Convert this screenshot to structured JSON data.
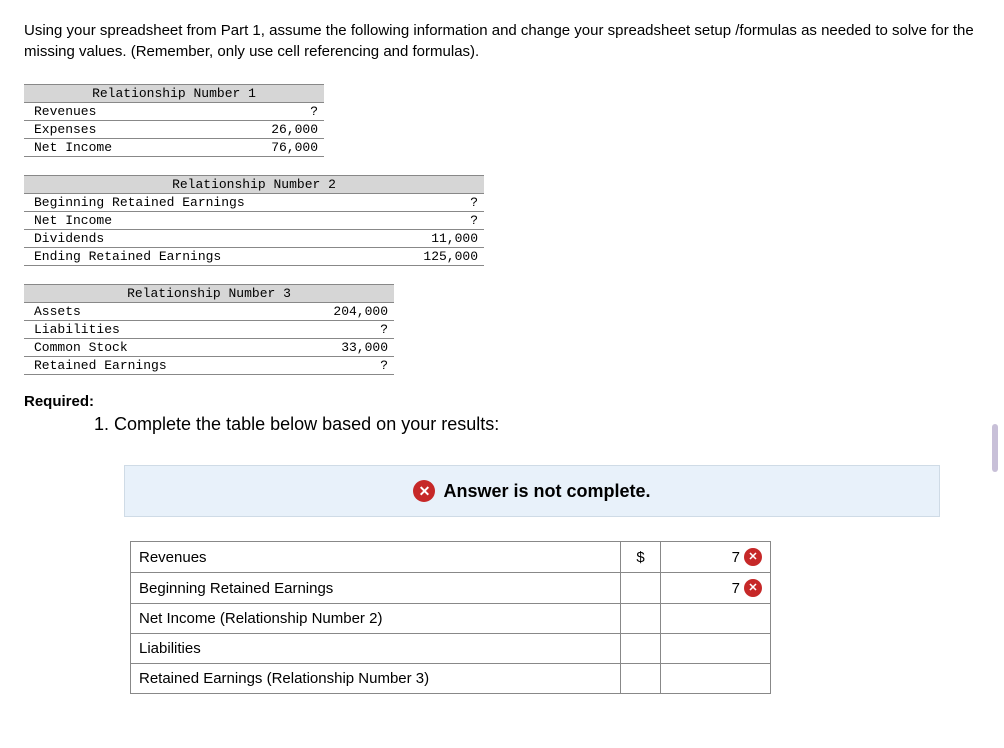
{
  "instructions": "Using your spreadsheet from Part 1, assume the following information and change your spreadsheet setup /formulas as needed to solve for the missing values. (Remember, only use cell referencing and formulas).",
  "rel1": {
    "title": "Relationship Number 1",
    "rows": [
      {
        "label": "Revenues",
        "value": "?"
      },
      {
        "label": "Expenses",
        "value": "26,000"
      },
      {
        "label": "Net Income",
        "value": "76,000"
      }
    ]
  },
  "rel2": {
    "title": "Relationship Number 2",
    "rows": [
      {
        "label": "Beginning Retained Earnings",
        "value": "?"
      },
      {
        "label": "Net Income",
        "value": "?"
      },
      {
        "label": "Dividends",
        "value": "11,000"
      },
      {
        "label": "Ending Retained Earnings",
        "value": "125,000"
      }
    ]
  },
  "rel3": {
    "title": "Relationship Number 3",
    "rows": [
      {
        "label": "Assets",
        "value": "204,000"
      },
      {
        "label": "Liabilities",
        "value": "?"
      },
      {
        "label": "Common Stock",
        "value": "33,000"
      },
      {
        "label": "Retained Earnings",
        "value": "?"
      }
    ]
  },
  "required_label": "Required:",
  "question": "1. Complete the table below based on your results:",
  "status_banner": "Answer is not complete.",
  "answer_table": {
    "rows": [
      {
        "label": "Revenues",
        "currency": "$",
        "value": "7",
        "wrong": true
      },
      {
        "label": "Beginning Retained Earnings",
        "currency": "",
        "value": "7",
        "wrong": true
      },
      {
        "label": "Net Income (Relationship Number 2)",
        "currency": "",
        "value": "",
        "wrong": false
      },
      {
        "label": "Liabilities",
        "currency": "",
        "value": "",
        "wrong": false
      },
      {
        "label": "Retained Earnings (Relationship Number 3)",
        "currency": "",
        "value": "",
        "wrong": false
      }
    ]
  }
}
